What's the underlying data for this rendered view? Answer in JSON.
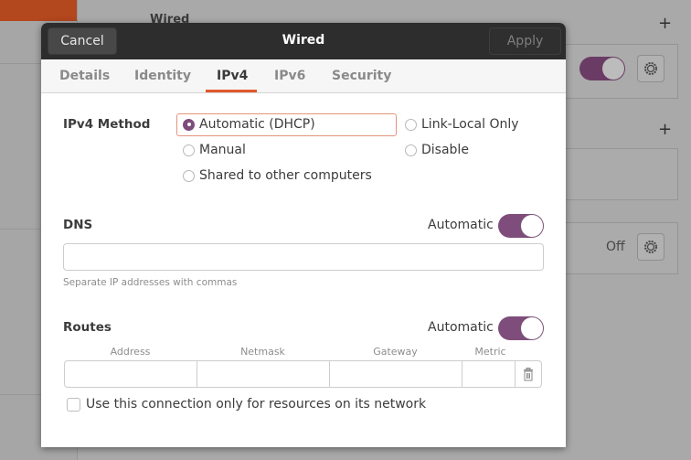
{
  "background": {
    "section_title": "Wired",
    "off_label": "Off",
    "wired_toggle_on": true
  },
  "dialog": {
    "title": "Wired",
    "cancel_label": "Cancel",
    "apply_label": "Apply",
    "tabs": [
      {
        "label": "Details",
        "active": false
      },
      {
        "label": "Identity",
        "active": false
      },
      {
        "label": "IPv4",
        "active": true
      },
      {
        "label": "IPv6",
        "active": false
      },
      {
        "label": "Security",
        "active": false
      }
    ],
    "ipv4_method": {
      "label": "IPv4 Method",
      "options": [
        {
          "label": "Automatic (DHCP)",
          "checked": true
        },
        {
          "label": "Link-Local Only",
          "checked": false
        },
        {
          "label": "Manual",
          "checked": false
        },
        {
          "label": "Disable",
          "checked": false
        },
        {
          "label": "Shared to other computers",
          "checked": false
        }
      ]
    },
    "dns": {
      "label": "DNS",
      "automatic_label": "Automatic",
      "automatic_on": true,
      "value": "",
      "hint": "Separate IP addresses with commas"
    },
    "routes": {
      "label": "Routes",
      "automatic_label": "Automatic",
      "automatic_on": true,
      "columns": [
        "Address",
        "Netmask",
        "Gateway",
        "Metric"
      ],
      "rows": [
        {
          "address": "",
          "netmask": "",
          "gateway": "",
          "metric": ""
        }
      ]
    },
    "only_local_resources": {
      "label": "Use this connection only for resources on its network",
      "checked": false
    }
  },
  "colors": {
    "accent": "#7e4d7b",
    "tab_underline": "#e0592b",
    "header_bg": "#2d2d2d"
  }
}
